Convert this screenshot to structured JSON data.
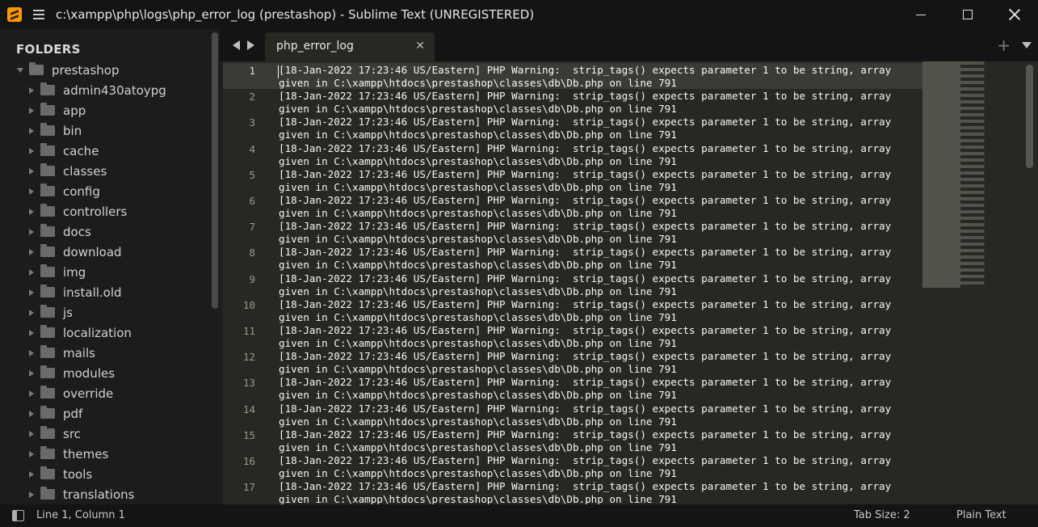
{
  "window": {
    "title": "c:\\xampp\\php\\logs\\php_error_log (prestashop) - Sublime Text (UNREGISTERED)"
  },
  "sidebar": {
    "header": "FOLDERS",
    "root": "prestashop",
    "items": [
      "admin430atoypg",
      "app",
      "bin",
      "cache",
      "classes",
      "config",
      "controllers",
      "docs",
      "download",
      "img",
      "install.old",
      "js",
      "localization",
      "mails",
      "modules",
      "override",
      "pdf",
      "src",
      "themes",
      "tools",
      "translations"
    ]
  },
  "tabs": [
    {
      "label": "php_error_log",
      "active": true
    }
  ],
  "editor": {
    "line_numbers": [
      "1",
      "2",
      "3",
      "4",
      "5",
      "6",
      "7",
      "8",
      "9",
      "10",
      "11",
      "12",
      "13",
      "14",
      "15",
      "16",
      "17"
    ],
    "line_part1": "[18-Jan-2022 17:23:46 US/Eastern] PHP Warning:  strip_tags() expects parameter 1 to be string, array",
    "line_part2": "given in C:\\xampp\\htdocs\\prestashop\\classes\\db\\Db.php on line 791"
  },
  "statusbar": {
    "position": "Line 1, Column 1",
    "tab_size": "Tab Size: 2",
    "syntax": "Plain Text"
  },
  "icons": {
    "app": "sublime-text-icon",
    "menu": "hamburger-icon",
    "folder": "folder-icon",
    "panel": "panel-toggle-icon"
  },
  "colors": {
    "editor_bg": "#272822",
    "text": "#f8f8f2",
    "accent": "#ff9800"
  }
}
